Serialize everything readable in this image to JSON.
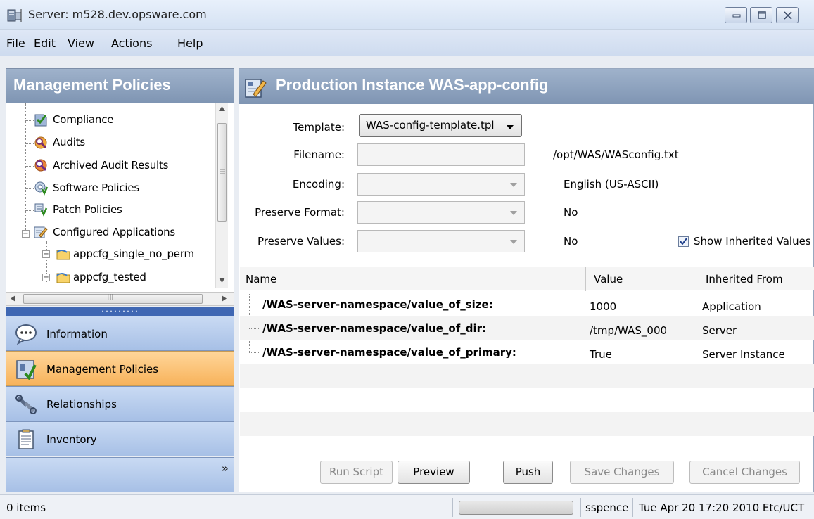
{
  "window": {
    "title": "Server: m528.dev.opsware.com"
  },
  "menu": [
    "File",
    "Edit",
    "View",
    "Actions",
    "Help"
  ],
  "left_panel": {
    "header": "Management Policies",
    "tree": [
      {
        "label": "Compliance",
        "icon": "compliance-icon"
      },
      {
        "label": "Audits",
        "icon": "audit-icon"
      },
      {
        "label": "Archived Audit Results",
        "icon": "archived-audit-icon"
      },
      {
        "label": "Software Policies",
        "icon": "software-policy-icon"
      },
      {
        "label": "Patch Policies",
        "icon": "patch-policy-icon"
      },
      {
        "label": "Configured Applications",
        "icon": "configured-apps-icon"
      },
      {
        "label": "appcfg_single_no_perm",
        "icon": "folder-icon"
      },
      {
        "label": "appcfg_tested",
        "icon": "folder-icon"
      }
    ],
    "hscroll_grip": "III",
    "nav": [
      {
        "label": "Information",
        "icon": "information-icon",
        "active": false
      },
      {
        "label": "Management Policies",
        "icon": "management-policies-icon",
        "active": true
      },
      {
        "label": "Relationships",
        "icon": "relationships-icon",
        "active": false
      },
      {
        "label": "Inventory",
        "icon": "inventory-icon",
        "active": false
      }
    ],
    "more_glyph": "»"
  },
  "right_panel": {
    "header": "Production Instance WAS-app-config",
    "form": {
      "template_label": "Template:",
      "template_value": "WAS-config-template.tpl",
      "filename_label": "Filename:",
      "filename_value": "/opt/WAS/WASconfig.txt",
      "encoding_label": "Encoding:",
      "encoding_value": "English (US-ASCII)",
      "preserve_format_label": "Preserve Format:",
      "preserve_format_value": "No",
      "preserve_values_label": "Preserve Values:",
      "preserve_values_value": "No",
      "show_inherited_label": "Show Inherited Values",
      "show_inherited_checked": true
    },
    "table": {
      "columns": [
        "Name",
        "Value",
        "Inherited From"
      ],
      "rows": [
        {
          "name": "/WAS-server-namespace/value_of_size:",
          "value": "1000",
          "inherited": "Application"
        },
        {
          "name": "/WAS-server-namespace/value_of_dir:",
          "value": "/tmp/WAS_000",
          "inherited": "Server"
        },
        {
          "name": "/WAS-server-namespace/value_of_primary:",
          "value": "True",
          "inherited": "Server Instance"
        }
      ]
    },
    "buttons": {
      "run_script": "Run Script",
      "preview": "Preview",
      "push": "Push",
      "save_changes": "Save Changes",
      "cancel_changes": "Cancel Changes"
    }
  },
  "status": {
    "items": "0 items",
    "user": "sspence",
    "datetime": "Tue Apr 20 17:20 2010 Etc/UCT"
  }
}
